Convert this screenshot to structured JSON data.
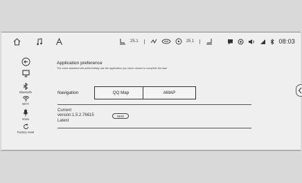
{
  "statusbar": {
    "home_icon": "home-icon",
    "music_icon": "music-note-icon",
    "nav_icon": "navigation-arrow-icon",
    "climate": {
      "left_temp": "25.1",
      "right_temp": "25.1"
    },
    "clock": "08:03"
  },
  "sidebar": {
    "items": [
      {
        "label": "",
        "icon": "back-arrow-icon"
      },
      {
        "label": "",
        "icon": "screen-icon"
      },
      {
        "label": "Bluetooth",
        "icon": "bluetooth-icon"
      },
      {
        "label": "Wi-Fi",
        "icon": "wifi-icon"
      },
      {
        "label": "Voice",
        "icon": "microphone-icon"
      },
      {
        "label": "Factory reset",
        "icon": "reset-icon"
      }
    ]
  },
  "preference": {
    "title": "Application preference",
    "description": "The voice assistant will preferentially use the application you have chosen to complete the task"
  },
  "navigation": {
    "label": "Navigation",
    "options": [
      "QQ Map",
      "AMAP"
    ]
  },
  "version": {
    "current_label": "Current",
    "version_text": "version:1.5.2.76615",
    "latest_label": "Latest",
    "badge": "NEW"
  }
}
